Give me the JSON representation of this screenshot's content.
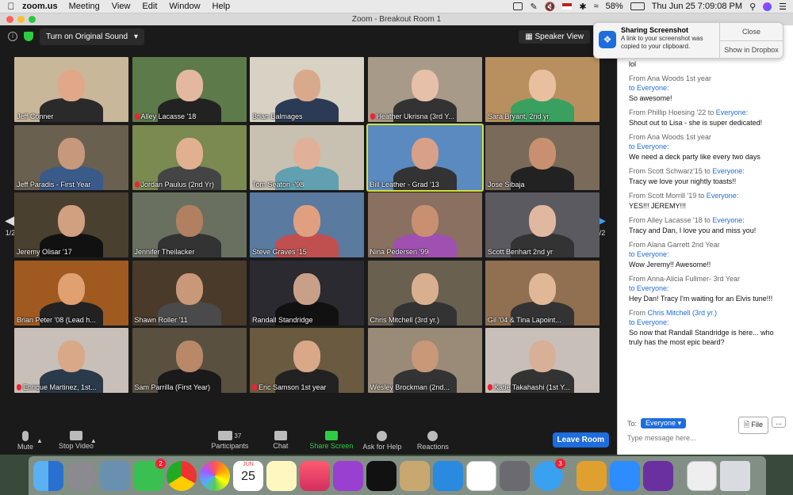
{
  "menubar": {
    "app": "zoom.us",
    "items": [
      "Meeting",
      "View",
      "Edit",
      "Window",
      "Help"
    ],
    "battery": "58%",
    "datetime": "Thu Jun 25  7:09:08 PM"
  },
  "window": {
    "title": "Zoom - Breakout Room 1"
  },
  "topbar": {
    "audio_button": "Turn on Original Sound",
    "view_button": "Speaker View"
  },
  "pagination": {
    "left": "1/2",
    "right": "1/2"
  },
  "participants": [
    {
      "name": "Jeff Conner",
      "muted": false,
      "bg": "#c9b79a",
      "skin": "#e0a888",
      "shirt": "#2a2a2a"
    },
    {
      "name": "Alley Lacasse '18",
      "muted": true,
      "bg": "#5d7a4a",
      "skin": "#e4b8a0",
      "shirt": "#222"
    },
    {
      "name": "Brian Balmages",
      "muted": false,
      "bg": "#d8d2c4",
      "skin": "#d9a98c",
      "shirt": "#2b3a55"
    },
    {
      "name": "Heather Ukrisna (3rd Y...",
      "muted": true,
      "bg": "#a89a88",
      "skin": "#e6c0a8",
      "shirt": "#333"
    },
    {
      "name": "Sara Bryant, 2nd yr",
      "muted": false,
      "bg": "#b89060",
      "skin": "#e8c0a0",
      "shirt": "#3aa060"
    },
    {
      "name": "Jeff Paradis - First Year",
      "muted": false,
      "bg": "#6a6050",
      "skin": "#c8987a",
      "shirt": "#3a5a8a"
    },
    {
      "name": "Jordan Paulus (2nd Yr)",
      "muted": true,
      "bg": "#7a8a50",
      "skin": "#e0b090",
      "shirt": "#444"
    },
    {
      "name": "Tom Seaton -'98",
      "muted": false,
      "bg": "#c8c0b0",
      "skin": "#e0b098",
      "shirt": "#60a0b0"
    },
    {
      "name": "Bill Leather - Grad '13",
      "muted": false,
      "bg": "#5a8ac0",
      "skin": "#d8a088",
      "shirt": "#333"
    },
    {
      "name": "Jose Sibaja",
      "muted": false,
      "bg": "#7a6a5a",
      "skin": "#c89070",
      "shirt": "#222"
    },
    {
      "name": "Jeremy Olisar '17",
      "muted": false,
      "bg": "#4a4030",
      "skin": "#d0a080",
      "shirt": "#111"
    },
    {
      "name": "Jennifer Theilacker",
      "muted": false,
      "bg": "#6a7060",
      "skin": "#b08060",
      "shirt": "#333"
    },
    {
      "name": "Steve Graves '15",
      "muted": false,
      "bg": "#5a7aa0",
      "skin": "#e0a080",
      "shirt": "#c05050"
    },
    {
      "name": "Nina Pedersen '99",
      "muted": false,
      "bg": "#8a7060",
      "skin": "#c89070",
      "shirt": "#a050b0"
    },
    {
      "name": "Scott Benhart 2nd yr",
      "muted": false,
      "bg": "#5a5a60",
      "skin": "#e0b8a0",
      "shirt": "#333"
    },
    {
      "name": "Brian Peter '08 (Lead h...",
      "muted": false,
      "bg": "#a05a20",
      "skin": "#e0a070",
      "shirt": "#222"
    },
    {
      "name": "Shawn Roller '11",
      "muted": false,
      "bg": "#4a3a2a",
      "skin": "#c89878",
      "shirt": "#4a4a4a"
    },
    {
      "name": "Randall Standridge",
      "muted": false,
      "bg": "#2a2a30",
      "skin": "#c8a088",
      "shirt": "#111"
    },
    {
      "name": "Chris Mitchell (3rd yr.)",
      "muted": false,
      "bg": "#6a6050",
      "skin": "#d8b090",
      "shirt": "#333"
    },
    {
      "name": "Gil  '04 & Tina Lapoint...",
      "muted": false,
      "bg": "#907050",
      "skin": "#e0b898",
      "shirt": "#333"
    },
    {
      "name": "Enrique Martinez, 1st...",
      "muted": true,
      "bg": "#c8c0b8",
      "skin": "#d8a888",
      "shirt": "#2a3a4a"
    },
    {
      "name": "Sam Parrilla (First Year)",
      "muted": false,
      "bg": "#5a5040",
      "skin": "#b88868",
      "shirt": "#1a1a1a"
    },
    {
      "name": "Eric Samson 1st year",
      "muted": true,
      "bg": "#6a5a40",
      "skin": "#d8a888",
      "shirt": "#222"
    },
    {
      "name": "Wesley Brockman (2nd...",
      "muted": false,
      "bg": "#9a8a78",
      "skin": "#c89878",
      "shirt": "#333"
    },
    {
      "name": "Katie Takahashi (1st Y...",
      "muted": true,
      "bg": "#c8c0b8",
      "skin": "#d8b098",
      "shirt": "#333"
    }
  ],
  "toolbar": {
    "mute": "Mute",
    "video": "Stop Video",
    "participants": "Participants",
    "participants_count": "37",
    "chat": "Chat",
    "share": "Share Screen",
    "help": "Ask for Help",
    "reactions": "Reactions",
    "leave": "Leave Room"
  },
  "notification": {
    "title": "Sharing Screenshot",
    "body": "A link to your screenshot was copied to your clipboard.",
    "close": "Close",
    "show": "Show in Dropbox"
  },
  "chat": {
    "messages": [
      {
        "from": "",
        "to": "to Everyone:",
        "text": "lol"
      },
      {
        "from": "From Ana Woods 1st year",
        "to": "to Everyone:",
        "text": "So awesome!"
      },
      {
        "from": "From Phillip Hoesing '22 to ",
        "to": "Everyone:",
        "text": "Shout out to Lisa - she is super dedicated!"
      },
      {
        "from": "From Ana Woods 1st year",
        "to": "to Everyone:",
        "text": "We need a deck party like every two days"
      },
      {
        "from": "From Scott Schwarz'15 to ",
        "to": "Everyone:",
        "text": "Tracy we love your nightly toasts!!"
      },
      {
        "from": "From Scott Morrill '19 to ",
        "to": "Everyone:",
        "text": "YES!!! JEREMY!!!"
      },
      {
        "from": "From Alley Lacasse '18 to ",
        "to": "Everyone:",
        "text": "Tracy and Dan, I love you and miss you!"
      },
      {
        "from": "From Alana Garrett 2nd Year",
        "to": "to Everyone:",
        "text": "Wow Jeremy!! Awesome!!"
      },
      {
        "from": "From Anna-Alicia Fullmer- 3rd Year",
        "to": "to Everyone:",
        "text": "Hey Dan! Tracy I'm waiting for an Elvis tune!!!"
      },
      {
        "from": "From ",
        "from_link": "Chris Mitchell (3rd yr.)",
        "to": "to Everyone:",
        "text": "So now that Randall Standridge is here... who truly has the most epic beard?"
      }
    ],
    "to_label": "To:",
    "to_value": "Everyone",
    "file": "File",
    "more": "...",
    "placeholder": "Type message here..."
  },
  "dock": {
    "badges": {
      "facetime": "2",
      "messages": "3"
    },
    "calendar_month": "JUN",
    "calendar_day": "25"
  }
}
